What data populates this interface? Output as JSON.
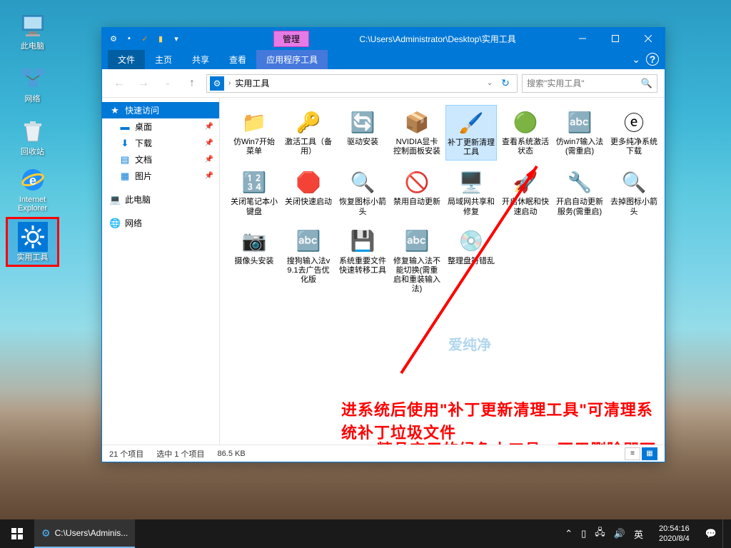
{
  "desktop": {
    "icons": [
      {
        "label": "此电脑",
        "icon": "💻"
      },
      {
        "label": "网络",
        "icon": "🌐"
      },
      {
        "label": "回收站",
        "icon": "🗑️"
      },
      {
        "label": "Internet Explorer",
        "icon": "ⓔ"
      },
      {
        "label": "实用工具",
        "icon": "⚙️"
      }
    ]
  },
  "explorer": {
    "titlebar_context": "管理",
    "titlebar_path": "C:\\Users\\Administrator\\Desktop\\实用工具",
    "ribbon": {
      "file": "文件",
      "tabs": [
        "主页",
        "共享",
        "查看"
      ],
      "context_tab": "应用程序工具"
    },
    "breadcrumb": {
      "current": "实用工具"
    },
    "search": {
      "placeholder": "搜索\"实用工具\""
    },
    "navpane": {
      "quickaccess": "快速访问",
      "items": [
        {
          "label": "桌面",
          "icon": "🟦"
        },
        {
          "label": "下载",
          "icon": "⬇"
        },
        {
          "label": "文档",
          "icon": "📄"
        },
        {
          "label": "图片",
          "icon": "🖼"
        }
      ],
      "thispc": "此电脑",
      "network": "网络"
    },
    "files": [
      {
        "label": "仿Win7开始菜单",
        "icon": "📁"
      },
      {
        "label": "激活工具（备用）",
        "icon": "🔑"
      },
      {
        "label": "驱动安装",
        "icon": "🔄"
      },
      {
        "label": "NVIDIA显卡控制面板安装",
        "icon": "📦"
      },
      {
        "label": "补丁更新清理工具",
        "icon": "🖌️",
        "selected": true
      },
      {
        "label": "查看系统激活状态",
        "icon": "🟢"
      },
      {
        "label": "仿win7输入法(需重启)",
        "icon": "🔤"
      },
      {
        "label": "更多纯净系统下载",
        "icon": "ⓔ"
      },
      {
        "label": "关闭笔记本小键盘",
        "icon": "🔢"
      },
      {
        "label": "关闭快速启动",
        "icon": "🛑"
      },
      {
        "label": "恢复图标小箭头",
        "icon": "🔍"
      },
      {
        "label": "禁用自动更新",
        "icon": "🚫"
      },
      {
        "label": "局域网共享和修复",
        "icon": "🖥️"
      },
      {
        "label": "开启休眠和快速启动",
        "icon": "🚀"
      },
      {
        "label": "开启自动更新服务(需重启)",
        "icon": "🔧"
      },
      {
        "label": "去掉图标小箭头",
        "icon": "🔍"
      },
      {
        "label": "摄像头安装",
        "icon": "📷"
      },
      {
        "label": "搜狗输入法v9.1去广告优化版",
        "icon": "🔤"
      },
      {
        "label": "系统重要文件快速转移工具",
        "icon": "💾"
      },
      {
        "label": "修复输入法不能切换(需重启和重装输入法)",
        "icon": "🔤"
      },
      {
        "label": "整理盘符错乱",
        "icon": "💿"
      }
    ],
    "statusbar": {
      "count": "21 个项目",
      "selected": "选中 1 个项目",
      "size": "86.5 KB"
    },
    "annotations": {
      "text1": "进系统后使用\"补丁更新清理工具\"可清理系统补丁垃圾文件",
      "text2": "精品实用的绿色小工具，不用删除即可",
      "watermark": "爱纯净"
    }
  },
  "taskbar": {
    "task_label": "C:\\Users\\Adminis...",
    "ime": "英",
    "time": "20:54:16",
    "date": "2020/8/4"
  }
}
